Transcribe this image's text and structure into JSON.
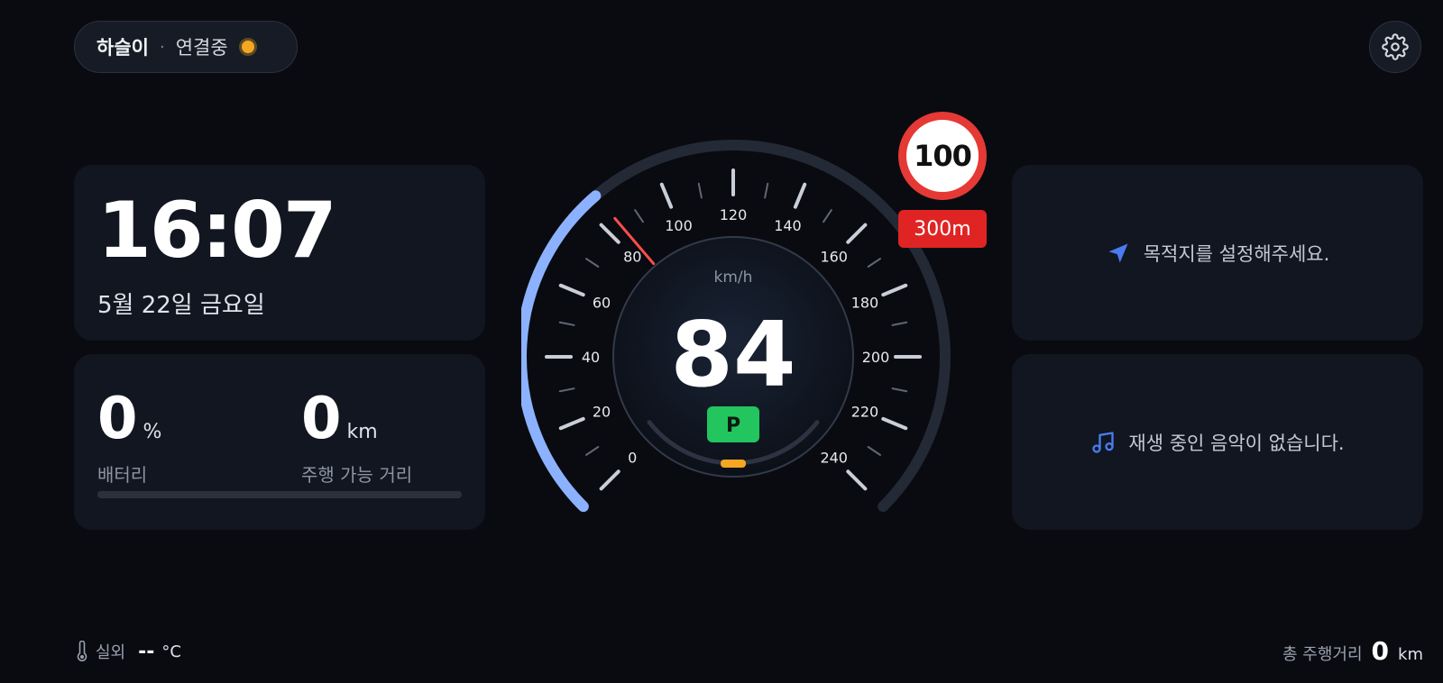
{
  "header": {
    "vehicle_name": "하슬이",
    "separator": "·",
    "connection_status": "연결중",
    "status_color": "#f5a623",
    "settings_icon": "gear-icon"
  },
  "clock": {
    "time": "16:07",
    "date": "5월 22일 금요일"
  },
  "battery": {
    "value": "0",
    "unit": "%",
    "label": "배터리",
    "level_percent": 0
  },
  "range": {
    "value": "0",
    "unit": "km",
    "label": "주행 가능 거리"
  },
  "speedometer": {
    "speed": "84",
    "speed_value": 84,
    "unit": "km/h",
    "gear": "P",
    "max": 240,
    "tick_labels": [
      "0",
      "20",
      "40",
      "60",
      "80",
      "100",
      "120",
      "140",
      "160",
      "180",
      "200",
      "220",
      "240"
    ],
    "arc_color": "#8cb2ff",
    "needle_color": "#ff4d4d",
    "gear_color": "#22c55e"
  },
  "speed_limit": {
    "limit": "100",
    "distance": "300m"
  },
  "navigation": {
    "icon": "navigation-arrow-icon",
    "message": "목적지를 설정해주세요."
  },
  "music": {
    "icon": "music-note-icon",
    "message": "재생 중인 음악이 없습니다."
  },
  "footer": {
    "temp_icon": "thermometer-icon",
    "temp_label": "실외",
    "temp_value": "--",
    "temp_unit": "°C",
    "odometer_label": "총 주행거리",
    "odometer_value": "0",
    "odometer_unit": "km"
  }
}
